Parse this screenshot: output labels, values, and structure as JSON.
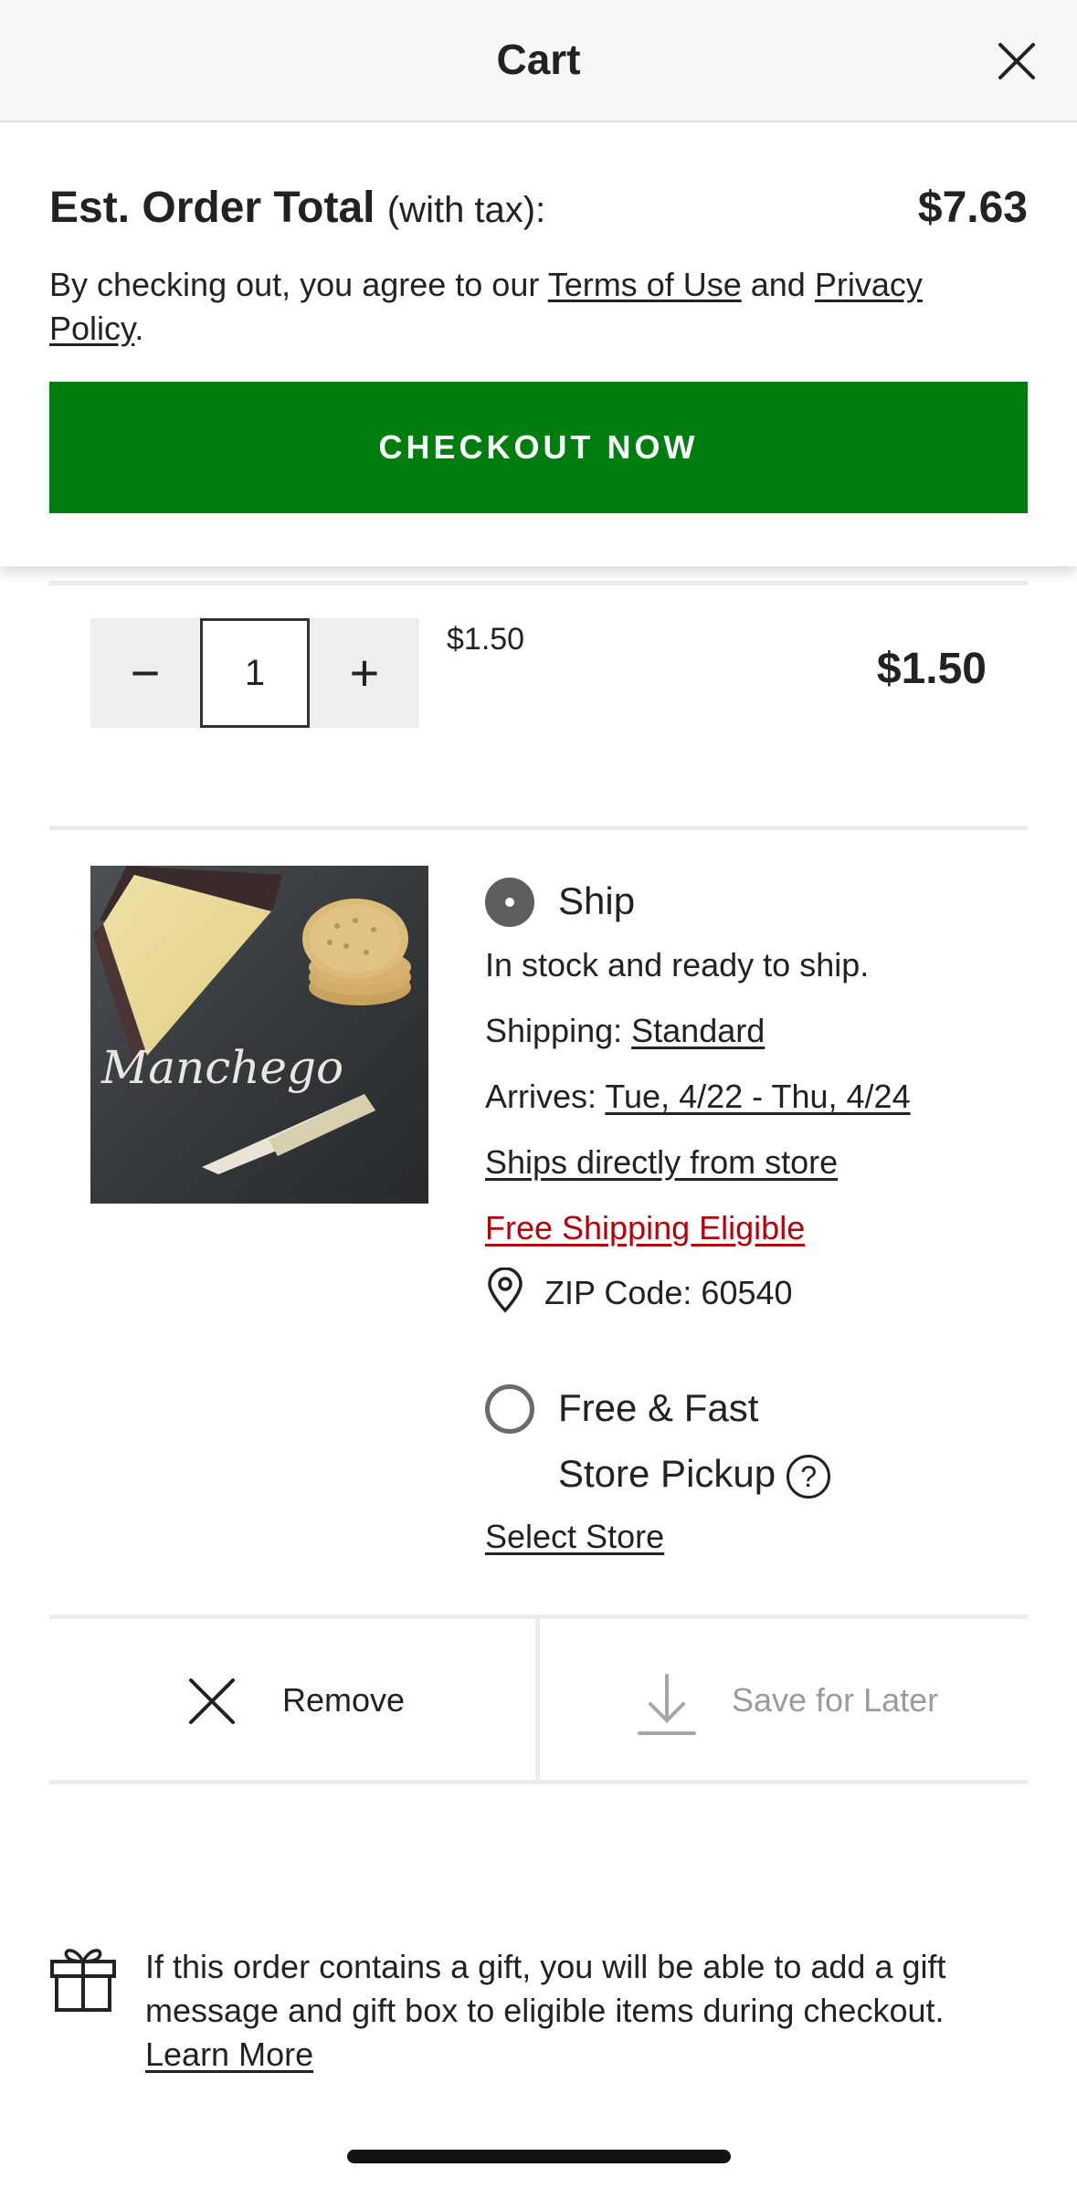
{
  "header": {
    "title": "Cart"
  },
  "summary": {
    "est_label": "Est. Order Total",
    "est_sub": "(with tax):",
    "total": "$7.63",
    "terms_prefix": "By checking out, you agree to our",
    "terms_link": "Terms of Use",
    "terms_and": "and",
    "privacy_link": "Privacy Policy",
    "terms_suffix": ".",
    "checkout_label": "CHECKOUT NOW"
  },
  "previous_item": {
    "minus": "−",
    "plus": "+",
    "quantity": "1",
    "unit_price": "$1.50",
    "line_total": "$1.50"
  },
  "item": {
    "image_text": "Manchego",
    "ship": {
      "label": "Ship",
      "selected": true,
      "stock": "In stock and ready to ship.",
      "shipping_prefix": "Shipping:",
      "shipping_method": "Standard",
      "arrives_prefix": "Arrives:",
      "arrives_dates": "Tue, 4/22 - Thu, 4/24",
      "ships_from": "Ships directly from store",
      "free_shipping": "Free Shipping Eligible",
      "zip": "ZIP Code: 60540"
    },
    "pickup": {
      "line1": "Free & Fast",
      "line2": "Store Pickup",
      "help": "?",
      "selected": false,
      "select_store": "Select Store"
    },
    "actions": {
      "remove": "Remove",
      "save_for_later": "Save for Later"
    }
  },
  "gift": {
    "text": "If this order contains a gift, you will be able to add a gift message and gift box to eligible items during checkout.",
    "learn_more": "Learn More"
  },
  "colors": {
    "checkout_green": "#007d0f",
    "free_shipping_red": "#b3030b"
  }
}
